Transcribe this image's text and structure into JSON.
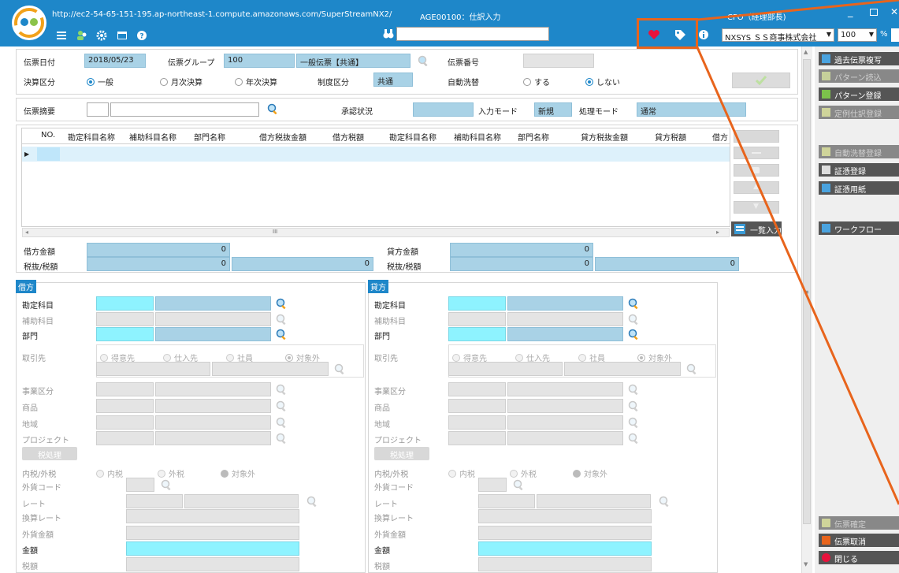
{
  "titlebar": {
    "url": "http://ec2-54-65-151-195.ap-northeast-1.compute.amazonaws.com/SuperStreamNX2/",
    "screen_id": "AGE00100：仕訳入力",
    "role": "CFO（経理部長)",
    "company": "NXSYS ＳＳ商事株式会社",
    "zoom": "100",
    "zoom_unit": "%",
    "search_value": ""
  },
  "header": {
    "slip_date_label": "伝票日付",
    "slip_date": "2018/05/23",
    "slip_group_label": "伝票グループ",
    "slip_group": "100",
    "slip_group_name": "一般伝票【共通】",
    "slip_no_label": "伝票番号",
    "slip_no": "",
    "settle_label": "決算区分",
    "settle_options": [
      "一般",
      "月次決算",
      "年次決算"
    ],
    "settle_selected": 0,
    "system_label": "制度区分",
    "system_value": "共通",
    "auto_reverse_label": "自動洗替",
    "auto_reverse_options": [
      "する",
      "しない"
    ],
    "auto_reverse_selected": 1,
    "summary_label": "伝票摘要",
    "summary_code": "",
    "summary_text": "",
    "approval_label": "承認状況",
    "approval_value": "",
    "input_mode_label": "入力モード",
    "input_mode": "新規",
    "process_mode_label": "処理モード",
    "process_mode": "通常"
  },
  "grid": {
    "columns": [
      "NO.",
      "勘定科目名称",
      "補助科目名称",
      "部門名称",
      "借方税抜金額",
      "借方税額",
      "勘定科目名称",
      "補助科目名称",
      "部門名称",
      "貸方税抜金額",
      "貸方税額",
      "借方"
    ],
    "scroll_mark": "III",
    "list_input_label": "一覧入力"
  },
  "totals": {
    "debit_label": "借方金額",
    "debit_value": "0",
    "credit_label": "貸方金額",
    "credit_value": "0",
    "tax_label": "税抜/税額",
    "debit_tax_ex": "0",
    "debit_tax": "0",
    "credit_tax_ex": "0",
    "credit_tax": "0"
  },
  "debit": {
    "title": "借方",
    "account_label": "勘定科目",
    "sub_account_label": "補助科目",
    "dept_label": "部門",
    "partner_label": "取引先",
    "partner_options": [
      "得意先",
      "仕入先",
      "社員",
      "対象外"
    ],
    "partner_selected": 3,
    "segment_label": "事業区分",
    "product_label": "商品",
    "region_label": "地域",
    "project_label": "プロジェクト",
    "tax_button": "税処理",
    "tax_type_label": "内税/外税",
    "tax_type_options": [
      "内税",
      "外税",
      "対象外"
    ],
    "tax_type_selected": 2,
    "currency_label": "外貨コード",
    "rate_label": "レート",
    "conv_rate_label": "換算レート",
    "fc_amount_label": "外貨金額",
    "amount_label": "金額",
    "tax_amount_label": "税額"
  },
  "credit": {
    "title": "貸方",
    "account_label": "勘定科目",
    "sub_account_label": "補助科目",
    "dept_label": "部門",
    "partner_label": "取引先",
    "partner_options": [
      "得意先",
      "仕入先",
      "社員",
      "対象外"
    ],
    "partner_selected": 3,
    "segment_label": "事業区分",
    "product_label": "商品",
    "region_label": "地域",
    "project_label": "プロジェクト",
    "tax_button": "税処理",
    "tax_type_label": "内税/外税",
    "tax_type_options": [
      "内税",
      "外税",
      "対象外"
    ],
    "tax_type_selected": 2,
    "currency_label": "外貨コード",
    "rate_label": "レート",
    "conv_rate_label": "換算レート",
    "fc_amount_label": "外貨金額",
    "amount_label": "金額",
    "tax_amount_label": "税額"
  },
  "sidebar": {
    "top": [
      "過去伝票複写",
      "パターン読込",
      "パターン登録",
      "定例仕訳登録",
      "自動洗替登録",
      "証憑登録",
      "証憑用紙",
      "ワークフロー"
    ],
    "bottom": [
      "伝票確定",
      "伝票取消",
      "閉じる"
    ]
  },
  "colors": {
    "titlebar": "#1e87c9",
    "highlight": "#e8641c",
    "field_blue": "#a9d2e6",
    "field_cyan": "#8ef3ff"
  },
  "icons": {
    "heart": "heart-icon",
    "tag": "tag-icon",
    "info": "info-icon",
    "search": "magnifier-icon"
  }
}
